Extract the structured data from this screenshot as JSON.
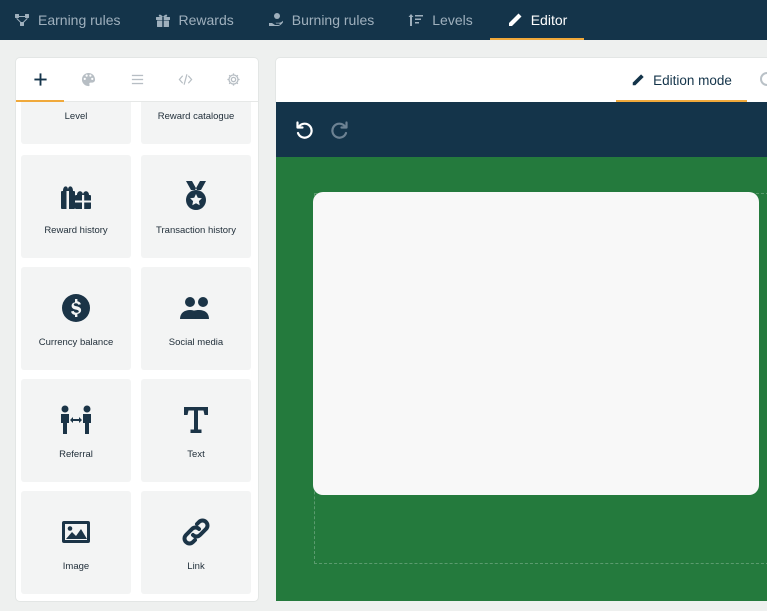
{
  "nav": {
    "items": [
      {
        "label": "Earning rules",
        "icon": "share-nodes-icon",
        "active": false
      },
      {
        "label": "Rewards",
        "icon": "gift-icon",
        "active": false
      },
      {
        "label": "Burning rules",
        "icon": "hand-coins-icon",
        "active": false
      },
      {
        "label": "Levels",
        "icon": "sort-levels-icon",
        "active": false
      },
      {
        "label": "Editor",
        "icon": "pencil-icon",
        "active": true
      }
    ]
  },
  "panel": {
    "tabs": [
      {
        "icon": "plus-icon",
        "active": true
      },
      {
        "icon": "palette-icon",
        "active": false
      },
      {
        "icon": "list-icon",
        "active": false
      },
      {
        "icon": "code-icon",
        "active": false
      },
      {
        "icon": "gear-icon",
        "active": false
      }
    ],
    "blocks": [
      {
        "label": "Level"
      },
      {
        "label": "Reward catalogue"
      },
      {
        "label": "Reward history",
        "icon": "gifts-icon"
      },
      {
        "label": "Transaction history",
        "icon": "medal-icon"
      },
      {
        "label": "Currency balance",
        "icon": "dollar-circle-icon"
      },
      {
        "label": "Social media",
        "icon": "users-icon"
      },
      {
        "label": "Referral",
        "icon": "referral-icon"
      },
      {
        "label": "Text",
        "icon": "text-icon"
      },
      {
        "label": "Image",
        "icon": "image-icon"
      },
      {
        "label": "Link",
        "icon": "link-icon"
      }
    ]
  },
  "editor": {
    "mode_label": "Edition mode",
    "colors": {
      "nav_bg": "#14344a",
      "accent": "#f0a93b",
      "canvas_bg": "#247a3d",
      "card_bg": "#f8f8f8"
    }
  }
}
